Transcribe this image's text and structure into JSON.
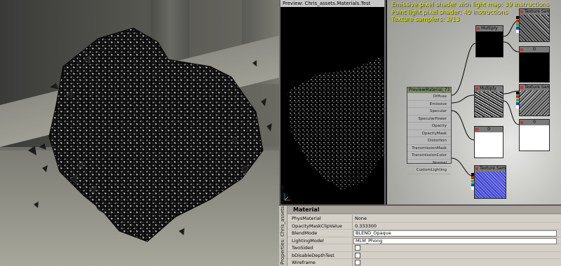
{
  "preview": {
    "title": "Preview: Chris_assets.Materials.Test"
  },
  "graph": {
    "stats": [
      "Emissive pixel shader with light map: 39 instructions",
      "Point light pixel shader: 40 instructions",
      "Texture samplers: 3/13"
    ],
    "nodes": {
      "texture_sample_1": "Texture Sample",
      "multiply_1": "Multiply",
      "constant_1": "0",
      "texture_sample_2": "Texture Sample",
      "multiply_2": "Multiply",
      "constant_2": "0",
      "constant_3": "0",
      "texture_sample_3": "Texture Sample",
      "material": "PreviewMaterial_73"
    },
    "material_inputs": [
      "Diffuse",
      "Emissive",
      "Specular",
      "SpecularPower",
      "Opacity",
      "OpacityMask",
      "Distortion",
      "TransmissionMask",
      "TransmissionColor",
      "Normal",
      "CustomLighting"
    ]
  },
  "properties": {
    "side_tab": "Properties: Chris_assets.Material",
    "title": "Material",
    "rows": [
      {
        "name": "PhysMaterial",
        "value": "None"
      },
      {
        "name": "OpacityMaskClipValue",
        "value": "0.333300"
      },
      {
        "name": "BlendMode",
        "value": "BLEND_Opaque"
      },
      {
        "name": "LightingModel",
        "value": "MLM_Phong"
      },
      {
        "name": "TwoSided",
        "value": ""
      },
      {
        "name": "bDisableDepthTest",
        "value": ""
      },
      {
        "name": "Wireframe",
        "value": ""
      }
    ]
  },
  "colors": {
    "stats_text": "#e6e600",
    "node_header": "#7a7a7a",
    "material_header": "#7a8a6a",
    "panel_bg": "#d4d0c8"
  }
}
